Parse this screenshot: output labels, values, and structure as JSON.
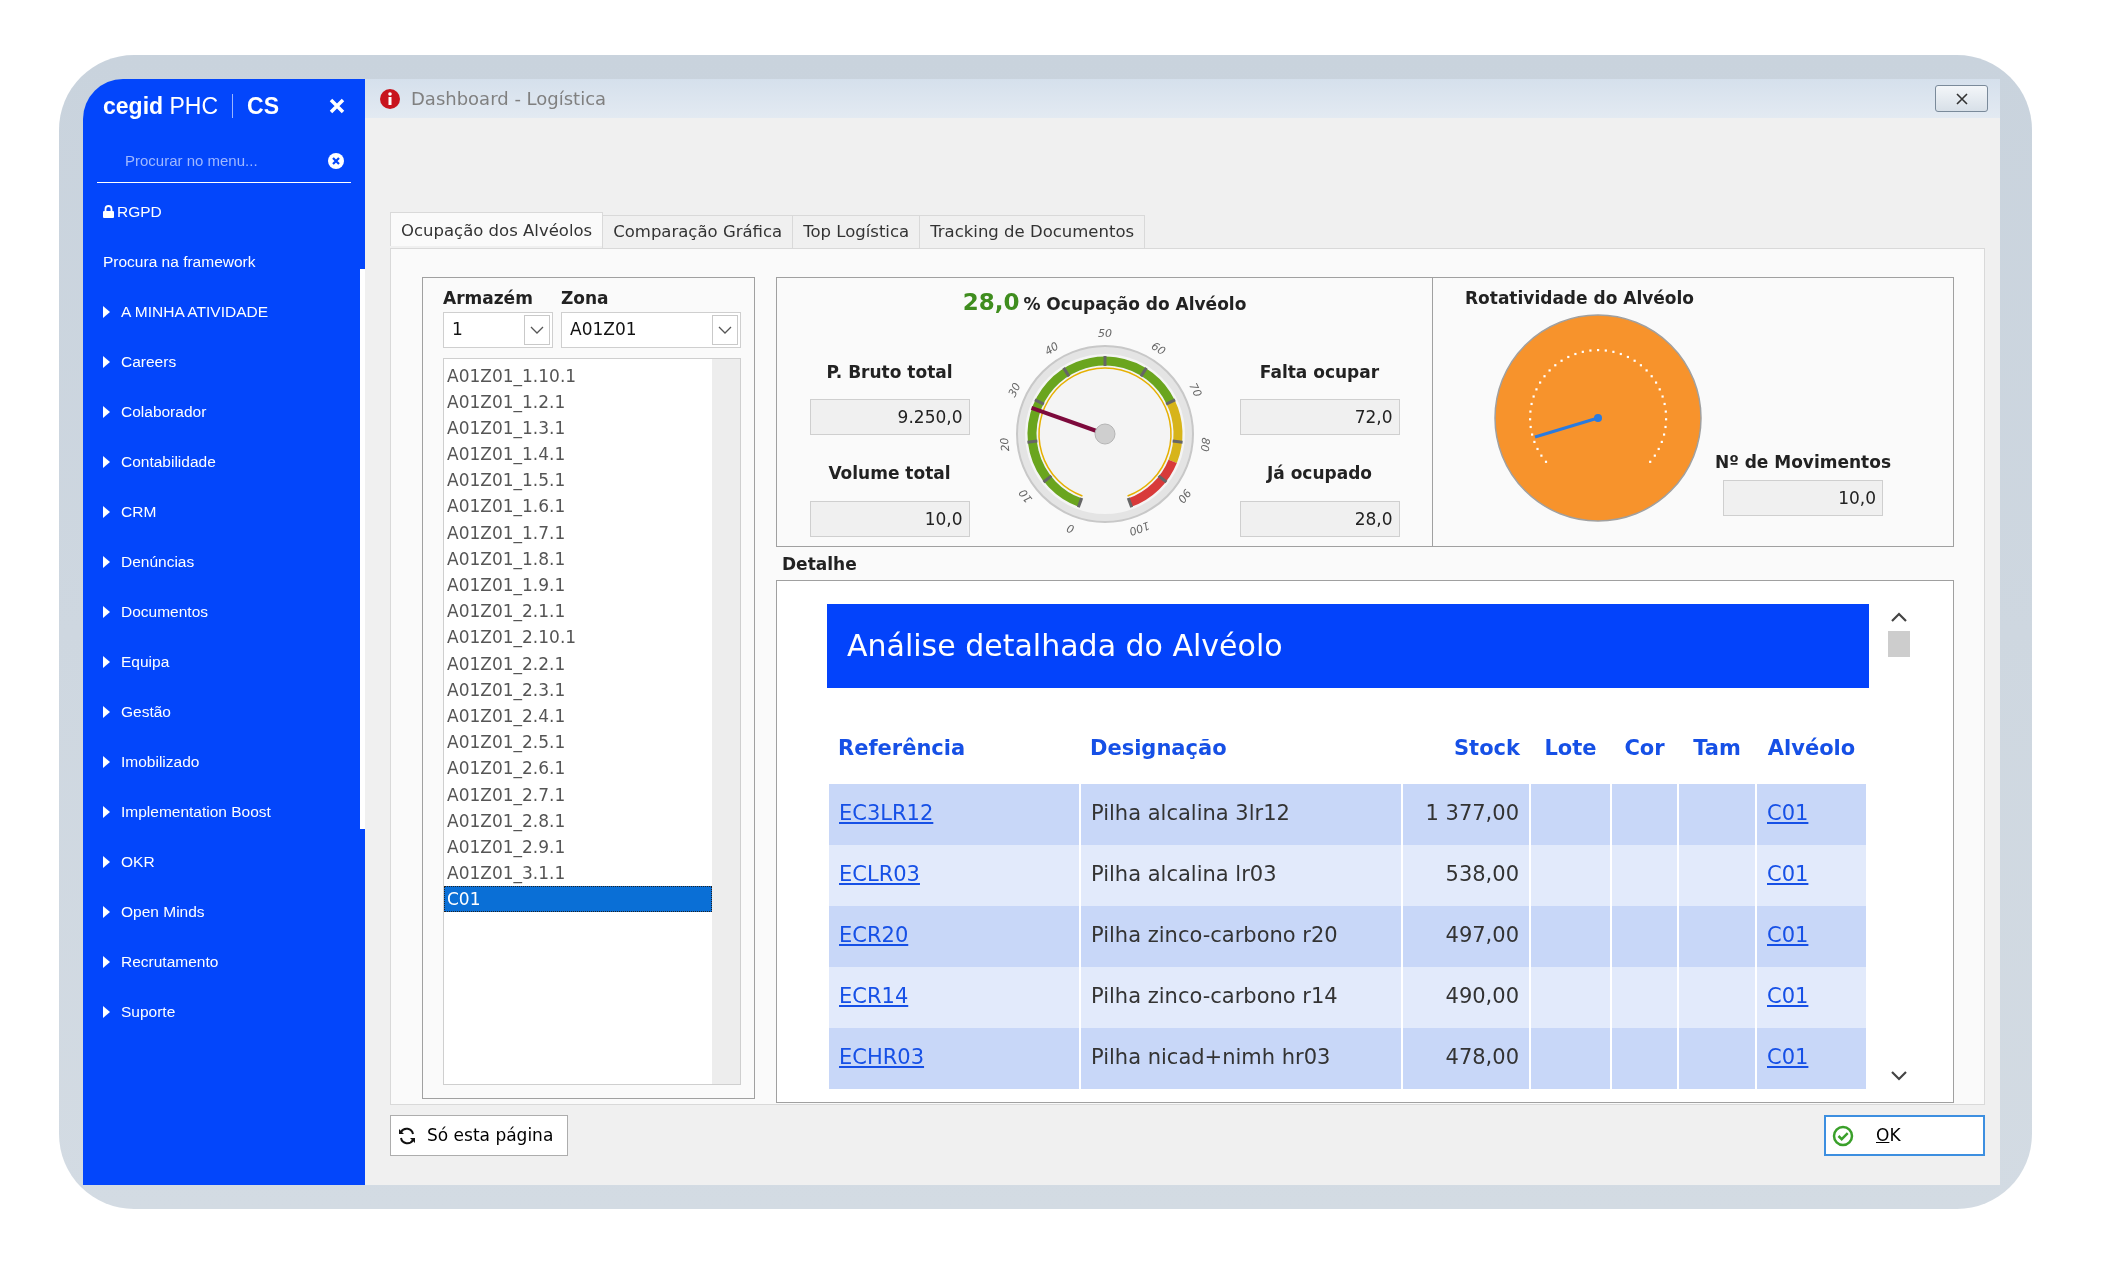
{
  "sidebar": {
    "brand": "cegid",
    "product": "PHC",
    "edition": "CS",
    "search": {
      "placeholder": "Procurar no menu..."
    },
    "items": [
      {
        "label": "RGPD",
        "kind": "locked"
      },
      {
        "label": "Procura na framework",
        "kind": "link"
      },
      {
        "label": "A MINHA ATIVIDADE",
        "kind": "group"
      },
      {
        "label": "Careers",
        "kind": "group"
      },
      {
        "label": "Colaborador",
        "kind": "group"
      },
      {
        "label": "Contabilidade",
        "kind": "group"
      },
      {
        "label": "CRM",
        "kind": "group"
      },
      {
        "label": "Denúncias",
        "kind": "group"
      },
      {
        "label": "Documentos",
        "kind": "group"
      },
      {
        "label": "Equipa",
        "kind": "group"
      },
      {
        "label": "Gestão",
        "kind": "group"
      },
      {
        "label": "Imobilizado",
        "kind": "group"
      },
      {
        "label": "Implementation Boost",
        "kind": "group"
      },
      {
        "label": "OKR",
        "kind": "group"
      },
      {
        "label": "Open Minds",
        "kind": "group"
      },
      {
        "label": "Recrutamento",
        "kind": "group"
      },
      {
        "label": "Suporte",
        "kind": "group"
      }
    ]
  },
  "window": {
    "title": "Dashboard - Logística"
  },
  "tabs": [
    {
      "label": "Ocupação dos Alvéolos",
      "selected": true
    },
    {
      "label": "Comparação Gráfica",
      "selected": false
    },
    {
      "label": "Top Logística",
      "selected": false
    },
    {
      "label": "Tracking de Documentos",
      "selected": false
    }
  ],
  "filters": {
    "warehouse_label": "Armazém",
    "warehouse_value": "1",
    "zone_label": "Zona",
    "zone_value": "A01Z01"
  },
  "bins": [
    {
      "label": "A01Z01_1.10.1",
      "selected": false
    },
    {
      "label": "A01Z01_1.2.1",
      "selected": false
    },
    {
      "label": "A01Z01_1.3.1",
      "selected": false
    },
    {
      "label": "A01Z01_1.4.1",
      "selected": false
    },
    {
      "label": "A01Z01_1.5.1",
      "selected": false
    },
    {
      "label": "A01Z01_1.6.1",
      "selected": false
    },
    {
      "label": "A01Z01_1.7.1",
      "selected": false
    },
    {
      "label": "A01Z01_1.8.1",
      "selected": false
    },
    {
      "label": "A01Z01_1.9.1",
      "selected": false
    },
    {
      "label": "A01Z01_2.1.1",
      "selected": false
    },
    {
      "label": "A01Z01_2.10.1",
      "selected": false
    },
    {
      "label": "A01Z01_2.2.1",
      "selected": false
    },
    {
      "label": "A01Z01_2.3.1",
      "selected": false
    },
    {
      "label": "A01Z01_2.4.1",
      "selected": false
    },
    {
      "label": "A01Z01_2.5.1",
      "selected": false
    },
    {
      "label": "A01Z01_2.6.1",
      "selected": false
    },
    {
      "label": "A01Z01_2.7.1",
      "selected": false
    },
    {
      "label": "A01Z01_2.8.1",
      "selected": false
    },
    {
      "label": "A01Z01_2.9.1",
      "selected": false
    },
    {
      "label": "A01Z01_3.1.1",
      "selected": false
    },
    {
      "label": "C01",
      "selected": true
    }
  ],
  "occupancy": {
    "value": "28,0",
    "title": "% Ocupação do Alvéolo",
    "level": 0.28,
    "scale": [
      "0",
      "10",
      "20",
      "30",
      "40",
      "50",
      "60",
      "70",
      "80",
      "90",
      "100"
    ],
    "left_fields": [
      {
        "label": "P. Bruto total",
        "value": "9.250,0"
      },
      {
        "label": "Volume total",
        "value": "10,0"
      }
    ],
    "right_fields": [
      {
        "label": "Falta ocupar",
        "value": "72,0"
      },
      {
        "label": "Já ocupado",
        "value": "28,0"
      }
    ]
  },
  "rotation": {
    "title": "Rotatividade do Alvéolo",
    "field": {
      "label": "Nº de Movimentos",
      "value": "10,0"
    }
  },
  "detail": {
    "label": "Detalhe",
    "banner": "Análise detalhada do Alvéolo",
    "columns": [
      "Referência",
      "Designação",
      "Stock",
      "Lote",
      "Cor",
      "Tam",
      "Alvéolo"
    ],
    "rows": [
      {
        "reference": "EC3LR12",
        "designation": "Pilha alcalina 3lr12",
        "stock": "1 377,00",
        "bin": "C01"
      },
      {
        "reference": "ECLR03",
        "designation": "Pilha alcalina lr03",
        "stock": "538,00",
        "bin": "C01"
      },
      {
        "reference": "ECR20",
        "designation": "Pilha zinco-carbono r20",
        "stock": "497,00",
        "bin": "C01"
      },
      {
        "reference": "ECR14",
        "designation": "Pilha zinco-carbono r14",
        "stock": "490,00",
        "bin": "C01"
      },
      {
        "reference": "ECHR03",
        "designation": "Pilha nicad+nimh hr03",
        "stock": "478,00",
        "bin": "C01"
      }
    ]
  },
  "footer": {
    "refresh_button": "Só esta página",
    "ok_button": "OK"
  }
}
